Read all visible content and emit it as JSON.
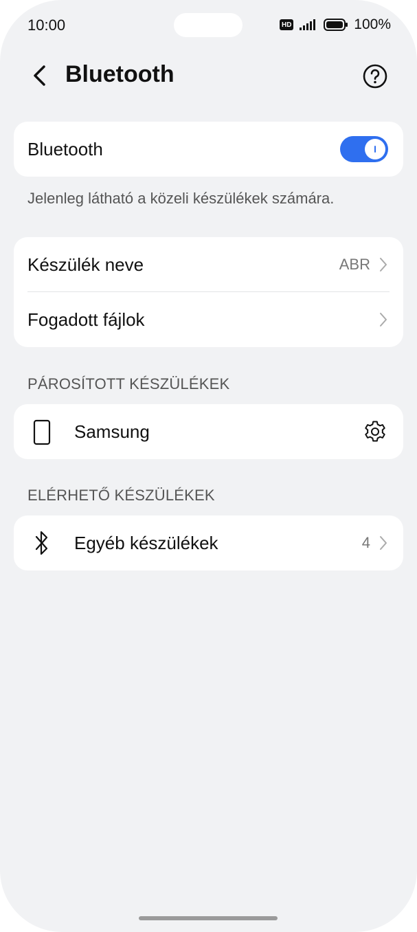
{
  "status_bar": {
    "time": "10:00",
    "hd_label": "HD",
    "battery": "100%"
  },
  "header": {
    "title": "Bluetooth"
  },
  "bluetooth_toggle": {
    "label": "Bluetooth",
    "enabled": true
  },
  "visibility_text": "Jelenleg látható a közeli készülékek számára.",
  "device_settings": {
    "device_name_label": "Készülék neve",
    "device_name_value": "ABR",
    "received_files_label": "Fogadott fájlok"
  },
  "paired": {
    "header": "PÁROSÍTOTT KÉSZÜLÉKEK",
    "items": [
      {
        "name": "Samsung",
        "icon": "phone-icon"
      }
    ]
  },
  "available": {
    "header": "ELÉRHETŐ KÉSZÜLÉKEK",
    "items": [
      {
        "name": "Egyéb készülékek",
        "count": "4",
        "icon": "bluetooth-icon"
      }
    ]
  },
  "colors": {
    "accent": "#2f6fef",
    "background": "#f1f2f4",
    "card": "#ffffff"
  }
}
